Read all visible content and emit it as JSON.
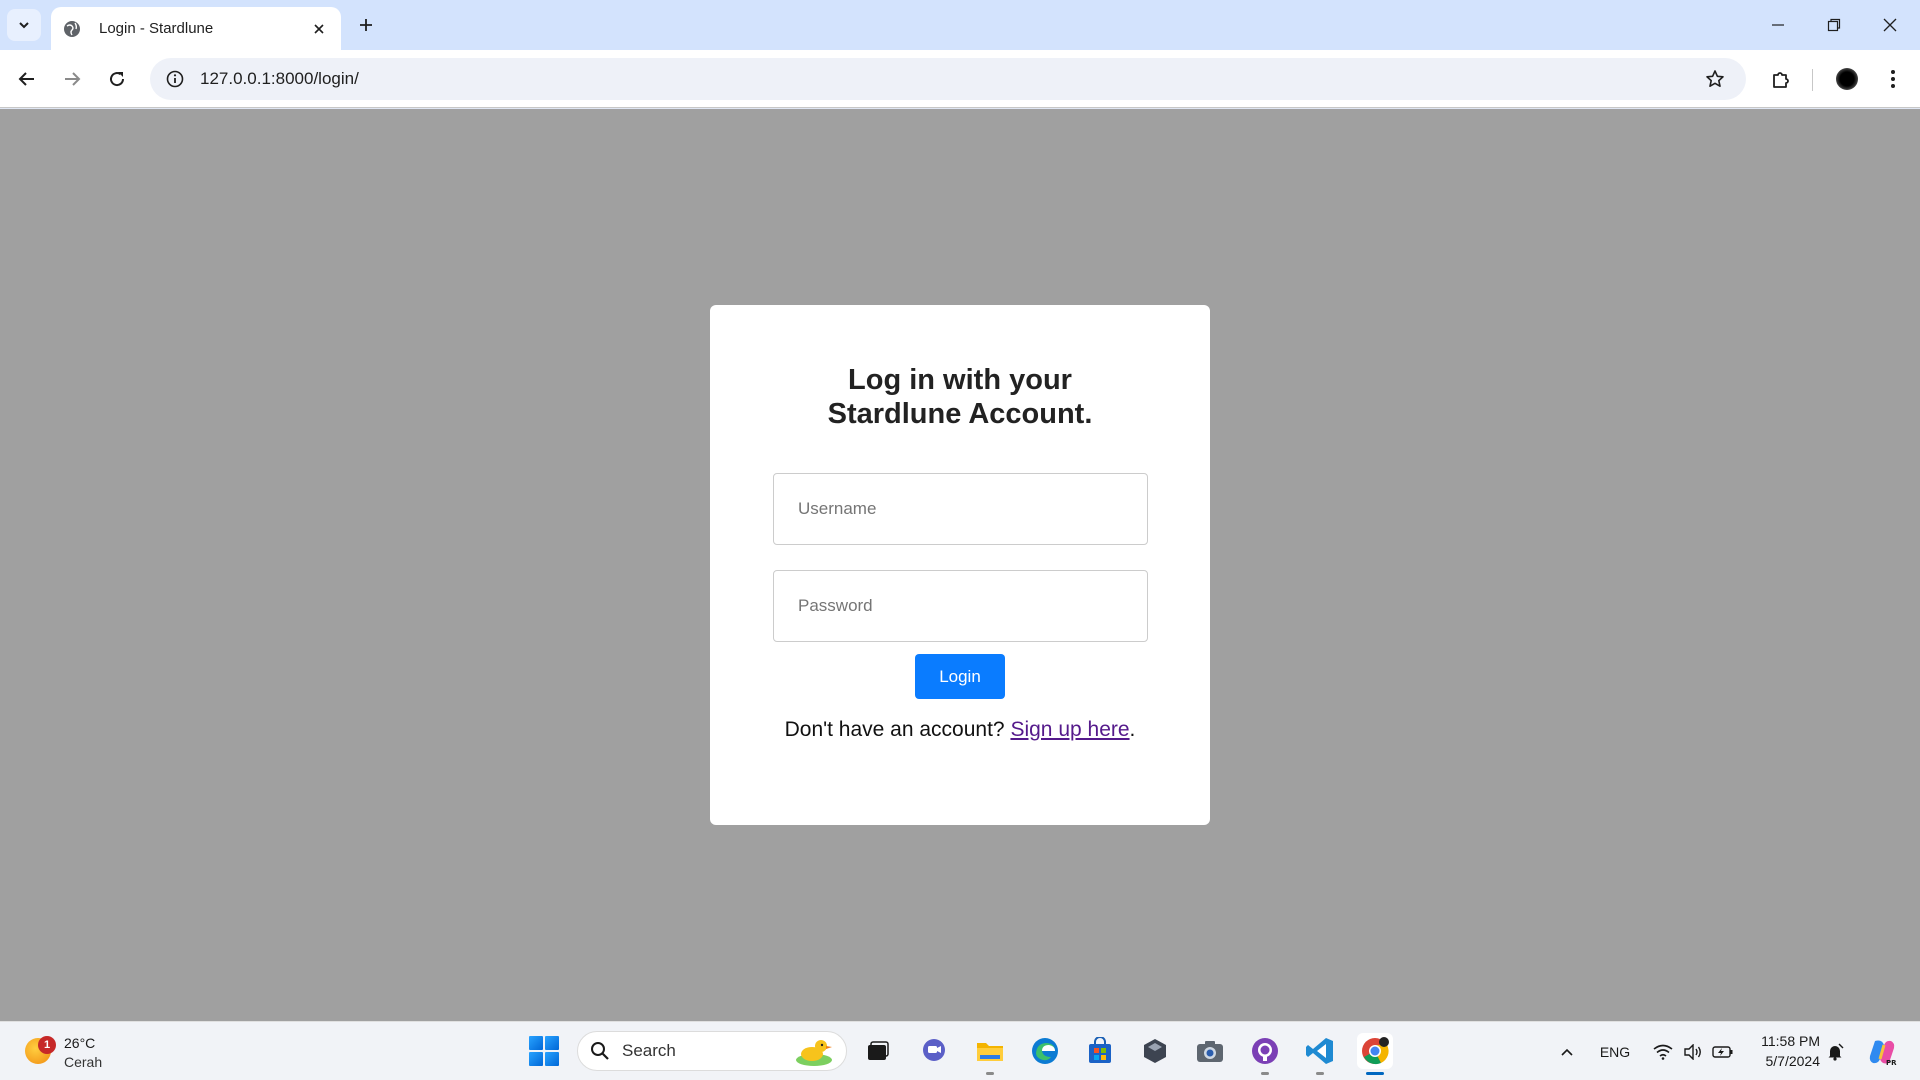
{
  "browser": {
    "tab": {
      "title": "Login - Stardlune"
    },
    "address_bar": {
      "url": "127.0.0.1:8000/login/"
    }
  },
  "login_card": {
    "heading_line1": "Log in with your",
    "heading_line2": "Stardlune Account.",
    "username_placeholder": "Username",
    "password_placeholder": "Password",
    "login_button": "Login",
    "signup_prompt": "Don't have an account?",
    "signup_link": "Sign up here",
    "signup_suffix": "."
  },
  "taskbar": {
    "weather": {
      "temp": "26°C",
      "condition": "Cerah",
      "badge": "1"
    },
    "search_label": "Search",
    "apps": [
      "task-view",
      "chat",
      "file-explorer",
      "edge",
      "store",
      "app-dark",
      "camera",
      "github-desktop",
      "vscode",
      "chrome"
    ],
    "tray": {
      "language": "ENG",
      "time": "11:58 PM",
      "date": "5/7/2024"
    }
  },
  "colors": {
    "page_background": "#a0a0a0",
    "login_button": "#0a7cff",
    "link": "#551a8b",
    "tab_strip": "#d3e3fd"
  }
}
